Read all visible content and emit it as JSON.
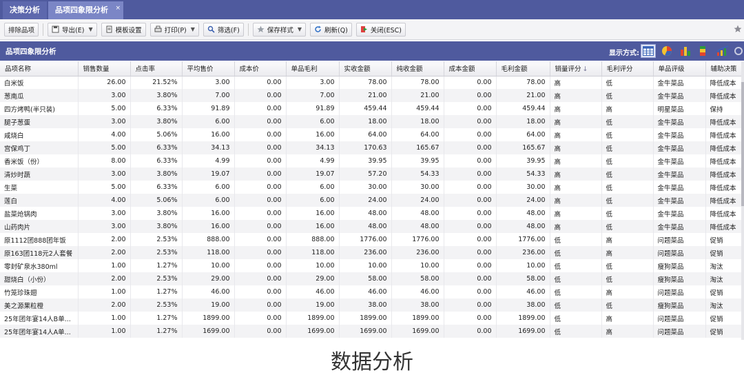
{
  "tabs": [
    {
      "label": "决策分析",
      "active": false
    },
    {
      "label": "品项四象限分析",
      "active": true
    }
  ],
  "tab_close": "×",
  "toolbar": {
    "exclude": "排除品项",
    "export": "导出(E)",
    "template": "模板设置",
    "print": "打印(P)",
    "filter": "筛选(F)",
    "save_style": "保存样式",
    "refresh": "刷新(Q)",
    "close": "关闭(ESC)",
    "caret": "▼"
  },
  "panel": {
    "title": "品项四象限分析",
    "display_mode_label": "显示方式:"
  },
  "colors": {
    "accent": "#4f5a9e",
    "tab_active": "#7b86c6"
  },
  "table": {
    "columns": [
      "品项名称",
      "销售数量",
      "点击率",
      "平均售价",
      "成本价",
      "单品毛利",
      "实收金额",
      "纯收金额",
      "成本金额",
      "毛利金额",
      "销量评分",
      "毛利评分",
      "单品评级",
      "辅助决策"
    ],
    "sort_indicator": "↓",
    "rows": [
      [
        "白米饭",
        "26.00",
        "21.52%",
        "3.00",
        "0.00",
        "3.00",
        "78.00",
        "78.00",
        "0.00",
        "78.00",
        "高",
        "低",
        "金牛菜品",
        "降低成本"
      ],
      [
        "葱南瓜",
        "3.00",
        "3.80%",
        "7.00",
        "0.00",
        "7.00",
        "21.00",
        "21.00",
        "0.00",
        "21.00",
        "高",
        "低",
        "金牛菜品",
        "降低成本"
      ],
      [
        "四方烤鸭(半只装)",
        "5.00",
        "6.33%",
        "91.89",
        "0.00",
        "91.89",
        "459.44",
        "459.44",
        "0.00",
        "459.44",
        "高",
        "高",
        "明星菜品",
        "保持"
      ],
      [
        "腿子葱蛋",
        "3.00",
        "3.80%",
        "6.00",
        "0.00",
        "6.00",
        "18.00",
        "18.00",
        "0.00",
        "18.00",
        "高",
        "低",
        "金牛菜品",
        "降低成本"
      ],
      [
        "咸烧白",
        "4.00",
        "5.06%",
        "16.00",
        "0.00",
        "16.00",
        "64.00",
        "64.00",
        "0.00",
        "64.00",
        "高",
        "低",
        "金牛菜品",
        "降低成本"
      ],
      [
        "宫保鸡丁",
        "5.00",
        "6.33%",
        "34.13",
        "0.00",
        "34.13",
        "170.63",
        "165.67",
        "0.00",
        "165.67",
        "高",
        "低",
        "金牛菜品",
        "降低成本"
      ],
      [
        "香米饭（份）",
        "8.00",
        "6.33%",
        "4.99",
        "0.00",
        "4.99",
        "39.95",
        "39.95",
        "0.00",
        "39.95",
        "高",
        "低",
        "金牛菜品",
        "降低成本"
      ],
      [
        "清炒时蔬",
        "3.00",
        "3.80%",
        "19.07",
        "0.00",
        "19.07",
        "57.20",
        "54.33",
        "0.00",
        "54.33",
        "高",
        "低",
        "金牛菜品",
        "降低成本"
      ],
      [
        "生菜",
        "5.00",
        "6.33%",
        "6.00",
        "0.00",
        "6.00",
        "30.00",
        "30.00",
        "0.00",
        "30.00",
        "高",
        "低",
        "金牛菜品",
        "降低成本"
      ],
      [
        "莲白",
        "4.00",
        "5.06%",
        "6.00",
        "0.00",
        "6.00",
        "24.00",
        "24.00",
        "0.00",
        "24.00",
        "高",
        "低",
        "金牛菜品",
        "降低成本"
      ],
      [
        "盐菜炝锅肉",
        "3.00",
        "3.80%",
        "16.00",
        "0.00",
        "16.00",
        "48.00",
        "48.00",
        "0.00",
        "48.00",
        "高",
        "低",
        "金牛菜品",
        "降低成本"
      ],
      [
        "山药肉片",
        "3.00",
        "3.80%",
        "16.00",
        "0.00",
        "16.00",
        "48.00",
        "48.00",
        "0.00",
        "48.00",
        "高",
        "低",
        "金牛菜品",
        "降低成本"
      ],
      [
        "原1112团888团年饭",
        "2.00",
        "2.53%",
        "888.00",
        "0.00",
        "888.00",
        "1776.00",
        "1776.00",
        "0.00",
        "1776.00",
        "低",
        "高",
        "问题菜品",
        "促销"
      ],
      [
        "原163团118元2人套餐",
        "2.00",
        "2.53%",
        "118.00",
        "0.00",
        "118.00",
        "236.00",
        "236.00",
        "0.00",
        "236.00",
        "低",
        "高",
        "问题菜品",
        "促销"
      ],
      [
        "零封矿泉水380ml",
        "1.00",
        "1.27%",
        "10.00",
        "0.00",
        "10.00",
        "10.00",
        "10.00",
        "0.00",
        "10.00",
        "低",
        "低",
        "瘦狗菜品",
        "淘汰"
      ],
      [
        "甜烧白（小份）",
        "2.00",
        "2.53%",
        "29.00",
        "0.00",
        "29.00",
        "58.00",
        "58.00",
        "0.00",
        "58.00",
        "低",
        "低",
        "瘦狗菜品",
        "淘汰"
      ],
      [
        "竹笼珍珠翅",
        "1.00",
        "1.27%",
        "46.00",
        "0.00",
        "46.00",
        "46.00",
        "46.00",
        "0.00",
        "46.00",
        "低",
        "高",
        "问题菜品",
        "促销"
      ],
      [
        "美之源果粒橙",
        "2.00",
        "2.53%",
        "19.00",
        "0.00",
        "19.00",
        "38.00",
        "38.00",
        "0.00",
        "38.00",
        "低",
        "低",
        "瘦狗菜品",
        "淘汰"
      ],
      [
        "25年团年宴14人B单...",
        "1.00",
        "1.27%",
        "1899.00",
        "0.00",
        "1899.00",
        "1899.00",
        "1899.00",
        "0.00",
        "1899.00",
        "低",
        "高",
        "问题菜品",
        "促销"
      ],
      [
        "25年团年宴14人A单...",
        "1.00",
        "1.27%",
        "1699.00",
        "0.00",
        "1699.00",
        "1699.00",
        "1699.00",
        "0.00",
        "1699.00",
        "低",
        "高",
        "问题菜品",
        "促销"
      ]
    ]
  },
  "caption": "数据分析"
}
